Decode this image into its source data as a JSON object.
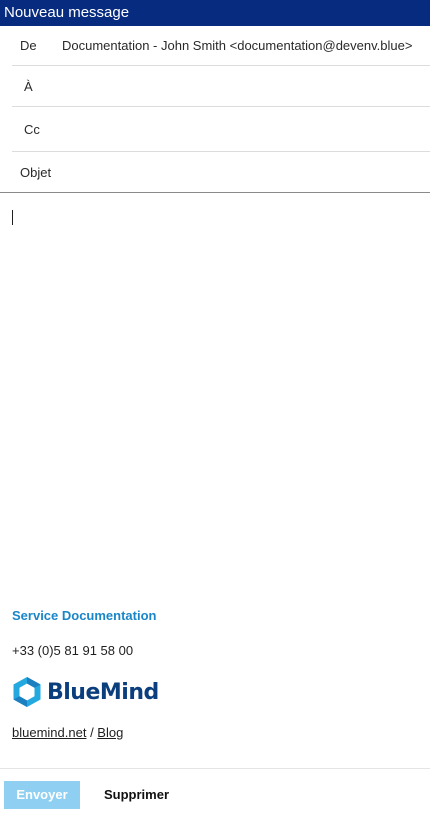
{
  "window": {
    "title": "Nouveau message"
  },
  "fields": {
    "from": {
      "label": "De",
      "value": "Documentation - John Smith <documentation@devenv.blue>"
    },
    "to": {
      "label": "À",
      "value": ""
    },
    "cc": {
      "label": "Cc",
      "value": ""
    },
    "subject": {
      "label": "Objet",
      "value": ""
    }
  },
  "body": {
    "text": ""
  },
  "signature": {
    "title": "Service Documentation",
    "phone": "+33 (0)5 81 91 58 00",
    "logo_text": "BlueMind",
    "logo_icon": "bluemind-hexagon-logo",
    "link1": "bluemind.net",
    "separator": " / ",
    "link2": "Blog"
  },
  "footer": {
    "send_label": "Envoyer",
    "delete_label": "Supprimer"
  },
  "colors": {
    "titlebar": "#072b7f",
    "accent": "#1a86c8",
    "send_button": "#8fd0f2",
    "logo_text": "#0b3e7c"
  }
}
